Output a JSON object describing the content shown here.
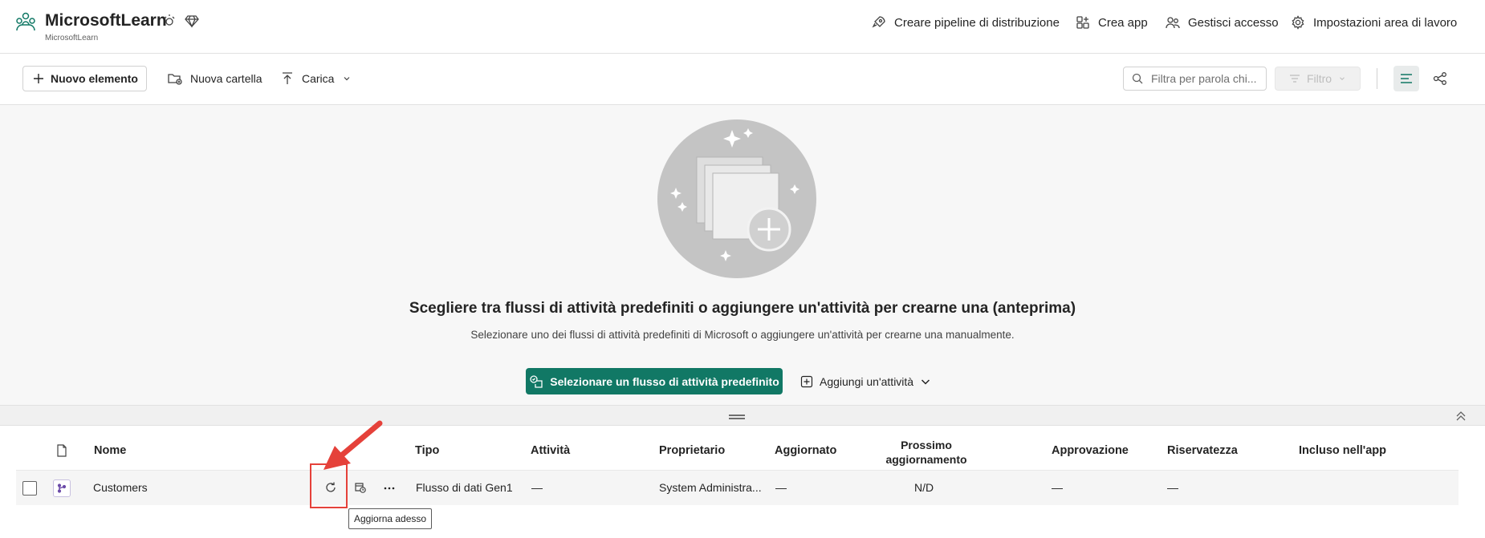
{
  "header": {
    "workspace_title": "MicrosoftLearn",
    "workspace_subtitle": "MicrosoftLearn",
    "actions": [
      {
        "label": "Creare pipeline di distribuzione",
        "icon": "rocket-icon"
      },
      {
        "label": "Crea app",
        "icon": "app-grid-icon"
      },
      {
        "label": "Gestisci accesso",
        "icon": "people-icon"
      },
      {
        "label": "Impostazioni area di lavoro",
        "icon": "gear-icon"
      }
    ]
  },
  "toolbar": {
    "new_item": "Nuovo elemento",
    "new_folder": "Nuova cartella",
    "upload": "Carica",
    "search_placeholder": "Filtra per parola chi...",
    "filter": "Filtro"
  },
  "empty_state": {
    "title": "Scegliere tra flussi di attività predefiniti o aggiungere un'attività per crearne una (anteprima)",
    "subtitle": "Selezionare uno dei flussi di attività predefiniti di Microsoft o aggiungere un'attività per crearne una manualmente.",
    "primary_button": "Selezionare un flusso di attività predefinito",
    "secondary_button": "Aggiungi un'attività"
  },
  "table": {
    "columns": {
      "name": "Nome",
      "type": "Tipo",
      "activity": "Attività",
      "owner": "Proprietario",
      "updated": "Aggiornato",
      "next_refresh": "Prossimo aggiornamento",
      "approval": "Approvazione",
      "sensitivity": "Riservatezza",
      "in_app": "Incluso nell'app"
    },
    "rows": [
      {
        "name": "Customers",
        "type": "Flusso di dati Gen1",
        "activity": "—",
        "owner": "System Administra...",
        "updated": "—",
        "next_refresh": "N/D",
        "approval": "—",
        "sensitivity": "—",
        "in_app": ""
      }
    ]
  },
  "tooltip": "Aggiorna adesso",
  "colors": {
    "accent": "#117865",
    "annotation": "#e5413a",
    "hero_bg": "#f7f7f7"
  }
}
